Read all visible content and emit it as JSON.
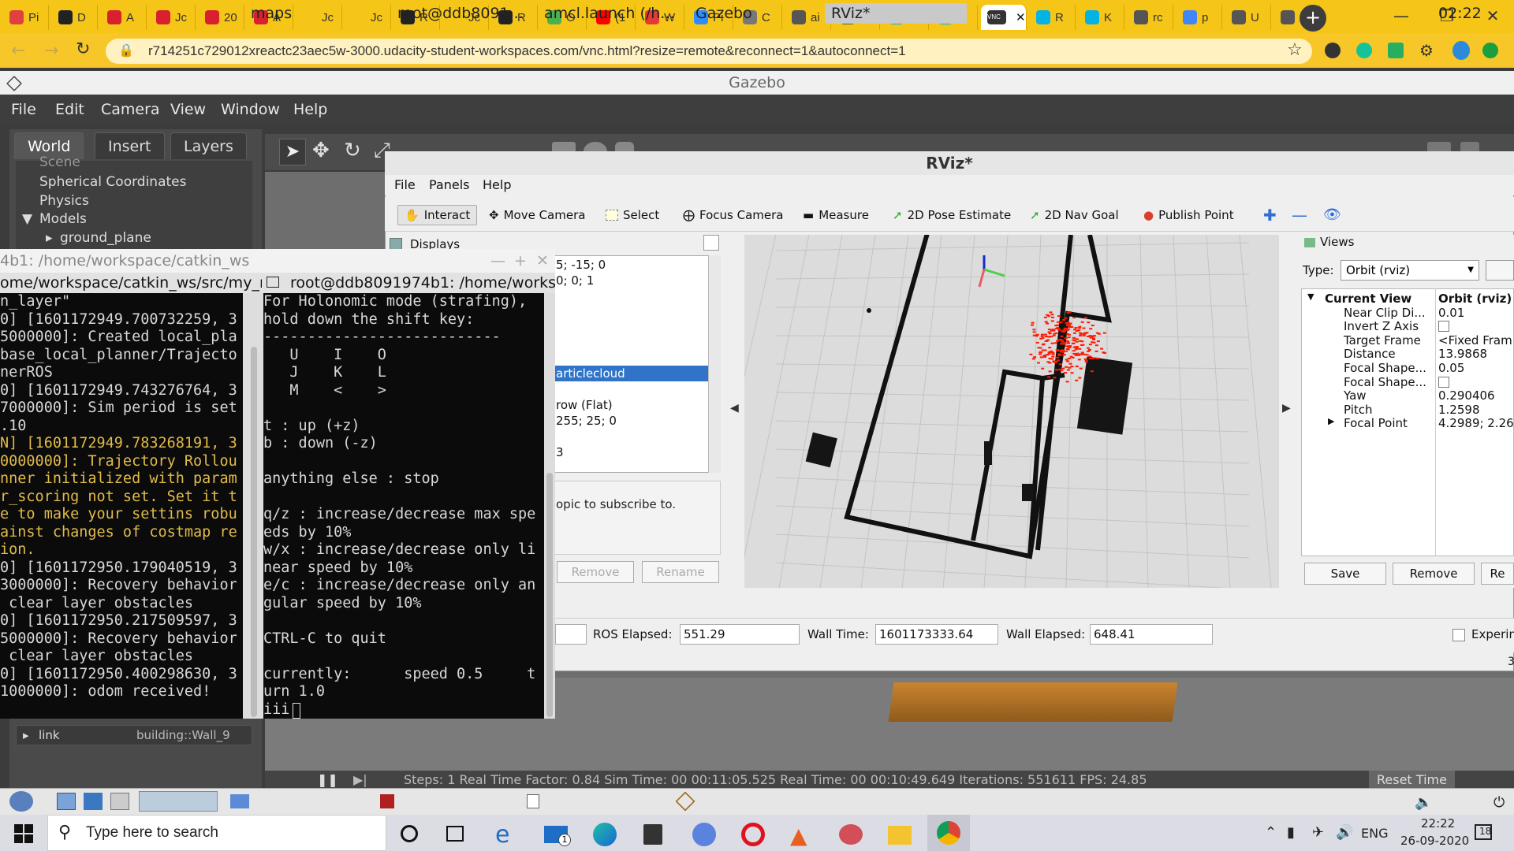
{
  "browser": {
    "tabs": [
      {
        "label": "Pi",
        "color": "#e04040"
      },
      {
        "label": "D",
        "color": "#222222"
      },
      {
        "label": "A",
        "color": "#d8202f"
      },
      {
        "label": "Jc",
        "color": "#d8202f"
      },
      {
        "label": "20",
        "color": "#d8202f"
      },
      {
        "label": "A",
        "color": "#d8202f"
      },
      {
        "label": "Jc",
        "color": "#f5c518"
      },
      {
        "label": "Jc",
        "color": "#f5c518"
      },
      {
        "label": "R",
        "color": "#222222"
      },
      {
        "label": "Jc",
        "color": "#f5c518"
      },
      {
        "label": "R",
        "color": "#222222"
      },
      {
        "label": "O",
        "color": "#4caf50"
      },
      {
        "label": "(1",
        "color": "#ff0000"
      },
      {
        "label": "W",
        "color": "#e53935"
      },
      {
        "label": "Pi",
        "color": "#2d8cff"
      },
      {
        "label": "C",
        "color": "#777777"
      },
      {
        "label": "ai",
        "color": "#555555"
      },
      {
        "label": "ai",
        "color": "#555555"
      },
      {
        "label": "R",
        "color": "#02b3e4"
      },
      {
        "label": "R",
        "color": "#02b3e4"
      },
      {
        "label": "",
        "color": "#333333"
      },
      {
        "label": "R",
        "color": "#02b3e4"
      },
      {
        "label": "K",
        "color": "#02b3e4"
      },
      {
        "label": "rc",
        "color": "#555555"
      },
      {
        "label": "p",
        "color": "#4285f4"
      },
      {
        "label": "U",
        "color": "#555555"
      },
      {
        "label": "n",
        "color": "#555555"
      }
    ],
    "active_tab_index": 20,
    "active_tab_badge": "VNC",
    "url": "r714251c729012xreactc23aec5w-3000.udacity-student-workspaces.com/vnc.html?resize=remote&reconnect=1&autoconnect=1"
  },
  "gazebo": {
    "title": "Gazebo",
    "menu": [
      "File",
      "Edit",
      "Camera",
      "View",
      "Window",
      "Help"
    ],
    "tabs": [
      "World",
      "Insert",
      "Layers"
    ],
    "tree": [
      "Scene",
      "Spherical Coordinates",
      "Physics",
      "Models",
      "ground_plane"
    ],
    "link_label": "link",
    "link_value": "building::Wall_9",
    "status": "Steps: 1     Real Time Factor: 0.84     Sim Time: 00 00:11:05.525     Real Time: 00 00:10:49.649     Iterations: 551611     FPS: 24.85",
    "reset_time": "Reset Time"
  },
  "terminal": {
    "title": "4b1: /home/workspace/catkin_ws",
    "tab_left": "ome/workspace/catkin_ws/src/my_robo",
    "tab_right": "root@ddb8091974b1: /home/workspace",
    "left_lines": [
      {
        "t": "n_layer\"",
        "c": "w"
      },
      {
        "t": "0] [1601172949.700732259, 3",
        "c": "w"
      },
      {
        "t": "5000000]: Created local_pla",
        "c": "w"
      },
      {
        "t": "base_local_planner/Trajecto",
        "c": "w"
      },
      {
        "t": "nerROS",
        "c": "w"
      },
      {
        "t": "0] [1601172949.743276764, 3",
        "c": "w"
      },
      {
        "t": "7000000]: Sim period is set",
        "c": "w"
      },
      {
        "t": ".10",
        "c": "w"
      },
      {
        "t": "N] [1601172949.783268191, 3",
        "c": "y"
      },
      {
        "t": "0000000]: Trajectory Rollou",
        "c": "y"
      },
      {
        "t": "nner initialized with param",
        "c": "y"
      },
      {
        "t": "r_scoring not set. Set it t",
        "c": "y"
      },
      {
        "t": "e to make your settins robu",
        "c": "y"
      },
      {
        "t": "ainst changes of costmap re",
        "c": "y"
      },
      {
        "t": "ion.",
        "c": "y"
      },
      {
        "t": "0] [1601172950.179040519, 3",
        "c": "w"
      },
      {
        "t": "3000000]: Recovery behavior",
        "c": "w"
      },
      {
        "t": " clear layer obstacles",
        "c": "w"
      },
      {
        "t": "0] [1601172950.217509597, 3",
        "c": "w"
      },
      {
        "t": "5000000]: Recovery behavior",
        "c": "w"
      },
      {
        "t": " clear layer obstacles",
        "c": "w"
      },
      {
        "t": "0] [1601172950.400298630, 3",
        "c": "w"
      },
      {
        "t": "1000000]: odom received!",
        "c": "w"
      }
    ],
    "right_lines": [
      "For Holonomic mode (strafing),",
      "hold down the shift key:",
      "---------------------------",
      "   U    I    O",
      "   J    K    L",
      "   M    <    >",
      "",
      "t : up (+z)",
      "b : down (-z)",
      "",
      "anything else : stop",
      "",
      "q/z : increase/decrease max spe",
      "eds by 10%",
      "w/x : increase/decrease only li",
      "near speed by 10%",
      "e/c : increase/decrease only an",
      "gular speed by 10%",
      "",
      "CTRL-C to quit",
      "",
      "currently:      speed 0.5     t",
      "urn 1.0",
      "iii"
    ]
  },
  "rviz": {
    "title": "RViz*",
    "menu": [
      "File",
      "Panels",
      "Help"
    ],
    "tools": [
      "Interact",
      "Move Camera",
      "Select",
      "Focus Camera",
      "Measure",
      "2D Pose Estimate",
      "2D Nav Goal",
      "Publish Point"
    ],
    "displays_title": "Displays",
    "displays_rows": [
      "5; -15; 0",
      "0; 0; 1",
      "articlecloud",
      "row (Flat)",
      "255; 25; 0",
      "3"
    ],
    "displays_desc": "opic to subscribe to.",
    "btn_remove": "Remove",
    "btn_rename": "Rename",
    "views_title": "Views",
    "type_label": "Type:",
    "type_value": "Orbit (rviz)",
    "views_rows": [
      {
        "k": "Current View",
        "v": "Orbit (rviz)"
      },
      {
        "k": "Near Clip Di...",
        "v": "0.01"
      },
      {
        "k": "Invert Z Axis",
        "v": ""
      },
      {
        "k": "Target Frame",
        "v": "<Fixed Fram"
      },
      {
        "k": "Distance",
        "v": "13.9868"
      },
      {
        "k": "Focal Shape...",
        "v": "0.05"
      },
      {
        "k": "Focal Shape...",
        "v": "✓"
      },
      {
        "k": "Yaw",
        "v": "0.290406"
      },
      {
        "k": "Pitch",
        "v": "1.2598"
      },
      {
        "k": "Focal Point",
        "v": "4.2989; 2.26"
      }
    ],
    "views_save": "Save",
    "views_remove": "Remove",
    "views_re": "Re",
    "ros_elapsed_label": "ROS Elapsed:",
    "ros_elapsed": "551.29",
    "wall_time_label": "Wall Time:",
    "wall_time": "1601173333.64",
    "wall_elapsed_label": "Wall Elapsed:",
    "wall_elapsed": "648.41",
    "experimental": "Experin",
    "fps_frag": "3"
  },
  "vnc_taskbar": {
    "items": [
      "maps",
      "root@ddb8091...",
      "amcl.launch (/h...",
      "Gazebo",
      "RViz*"
    ],
    "clock": "02:22"
  },
  "win_taskbar": {
    "search_placeholder": "Type here to search",
    "lang": "ENG",
    "time": "22:22",
    "date": "26-09-2020",
    "notif": "18",
    "mail_badge": "1"
  },
  "colors": {
    "tab_strip": "#f5c518",
    "particles": "#ff1a00",
    "rviz_select": "#3074c9"
  }
}
